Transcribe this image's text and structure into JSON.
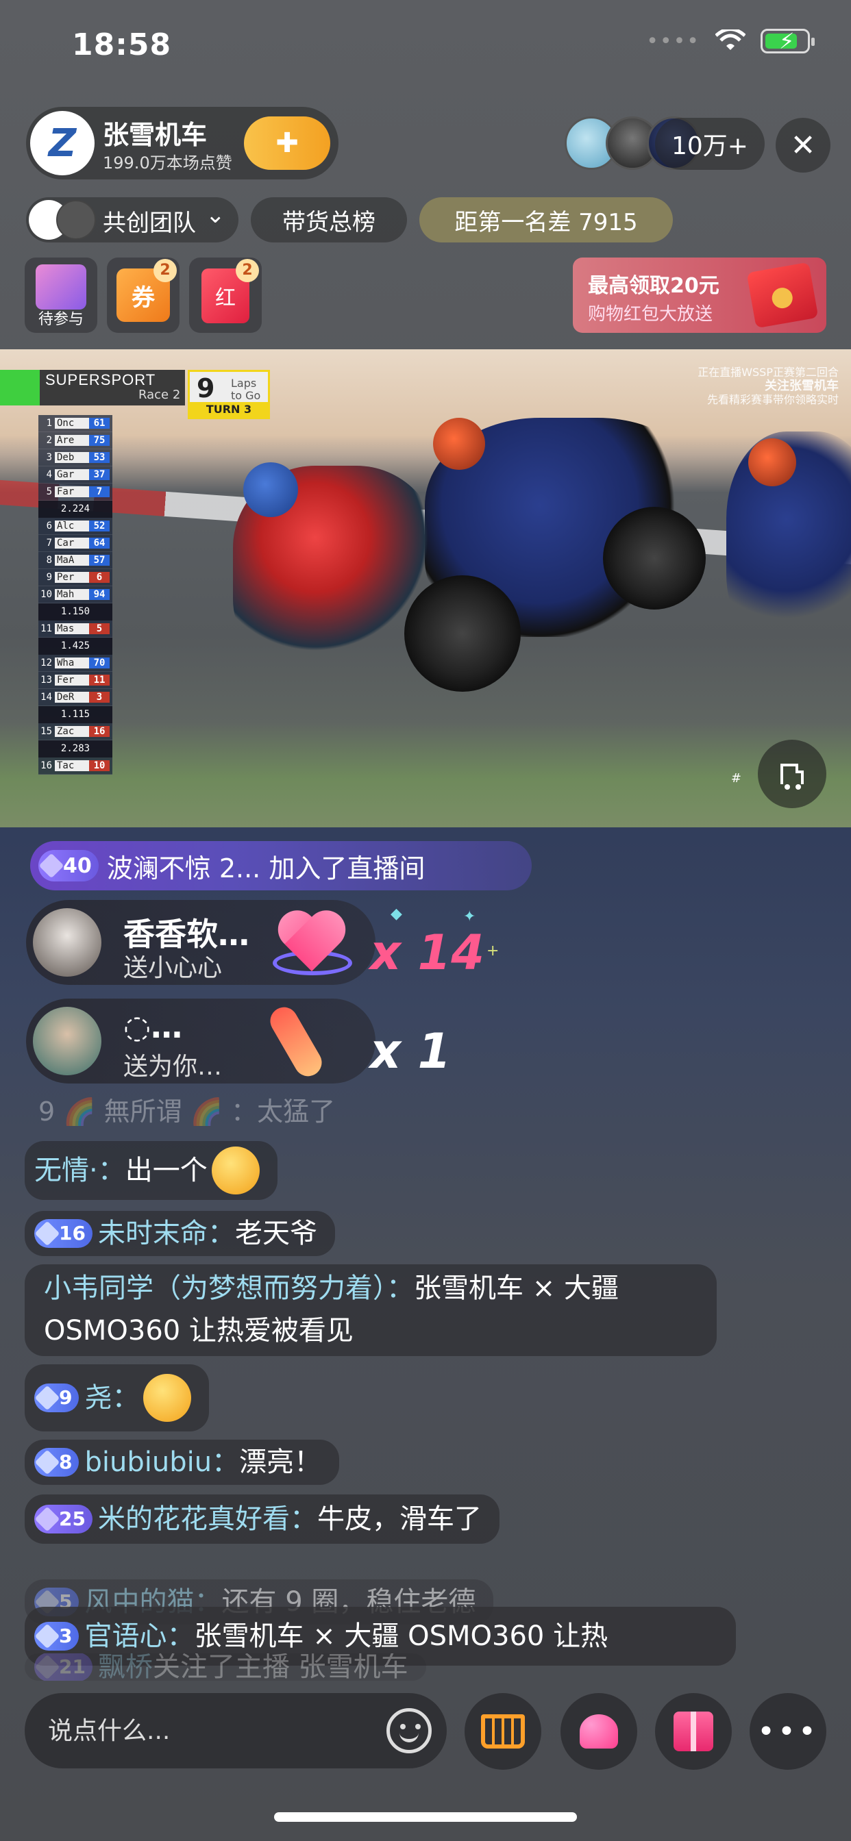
{
  "status_bar": {
    "time": "18:58"
  },
  "host": {
    "name": "张雪机车",
    "likes": "199.0万本场点赞",
    "follow_label": "✚"
  },
  "viewer_count": "10万+",
  "close_label": "✕",
  "team": {
    "label": "共创团队",
    "chevron": "⌄"
  },
  "rank_label": "带货总榜",
  "gap_label": "距第一名差 7915",
  "activities": [
    {
      "label": "待参与"
    },
    {
      "glyph": "券",
      "badge": "2"
    },
    {
      "glyph": "红",
      "badge": "2"
    }
  ],
  "redpacket": {
    "title": "最高领取20元",
    "subtitle": "购物红包大放送"
  },
  "video": {
    "series": "SUPERSPORT",
    "race": "Race 2",
    "laps_num": "9",
    "laps_label_1": "Laps",
    "laps_label_2": "to Go",
    "turn": "TURN 3",
    "watermark_1": "正在直播WSSP正赛第二回合",
    "watermark_2": "关注张雪机车",
    "watermark_3": "先看精彩赛事带你领略实时",
    "hash": "#",
    "standings": [
      {
        "pos": "1",
        "nm": "Onc",
        "num": "61",
        "color": "#2a66d8"
      },
      {
        "pos": "2",
        "nm": "Are",
        "num": "75",
        "color": "#2a66d8"
      },
      {
        "pos": "3",
        "nm": "Deb",
        "num": "53",
        "color": "#2a66d8"
      },
      {
        "pos": "4",
        "nm": "Gar",
        "num": "37",
        "color": "#2a66d8"
      },
      {
        "pos": "5",
        "nm": "Far",
        "num": "7",
        "color": "#2a66d8"
      },
      {
        "gap": "2.224"
      },
      {
        "pos": "6",
        "nm": "Alc",
        "num": "52",
        "color": "#2a66d8"
      },
      {
        "pos": "7",
        "nm": "Car",
        "num": "64",
        "color": "#2a66d8"
      },
      {
        "pos": "8",
        "nm": "MaA",
        "num": "57",
        "color": "#2a66d8"
      },
      {
        "pos": "9",
        "nm": "Per",
        "num": "6",
        "color": "#c0392b"
      },
      {
        "pos": "10",
        "nm": "Mah",
        "num": "94",
        "color": "#2a66d8"
      },
      {
        "gap": "1.150"
      },
      {
        "pos": "11",
        "nm": "Mas",
        "num": "5",
        "color": "#c0392b"
      },
      {
        "gap": "1.425"
      },
      {
        "pos": "12",
        "nm": "Wha",
        "num": "70",
        "color": "#2a66d8"
      },
      {
        "pos": "13",
        "nm": "Fer",
        "num": "11",
        "color": "#c0392b"
      },
      {
        "pos": "14",
        "nm": "DeR",
        "num": "3",
        "color": "#c0392b"
      },
      {
        "gap": "1.115"
      },
      {
        "pos": "15",
        "nm": "Zac",
        "num": "16",
        "color": "#c0392b"
      },
      {
        "gap": "2.283"
      },
      {
        "pos": "16",
        "nm": "Tac",
        "num": "10",
        "color": "#c0392b"
      }
    ]
  },
  "join": {
    "level": "40",
    "text": "波澜不惊 2... 加入了直播间"
  },
  "gifts": [
    {
      "name": "香香软…",
      "action": "送小心心",
      "count": "x 14"
    },
    {
      "name": "◌…",
      "action": "送为你…",
      "count": "x 1"
    }
  ],
  "faded_msg": "9 🌈 無所谓 🌈 ：太猛了",
  "messages": [
    {
      "user": "无情·：",
      "text": "出一个"
    },
    {
      "level": "16",
      "user": "未时末命：",
      "text": "老天爷"
    },
    {
      "user": "小韦同学（为梦想而努力着）：",
      "text": "张雪机车 × 大疆 OSMO360 让热爱被看见"
    },
    {
      "level": "9",
      "user": "尧：",
      "text": ""
    },
    {
      "level": "8",
      "user": "biubiubiu：",
      "text": "漂亮！"
    },
    {
      "level": "25",
      "user": "米的花花真好看：",
      "text": "牛皮，滑车了"
    },
    {
      "level": "5",
      "user": "风中的猫：",
      "text": "还有 9 圈，稳住老德"
    },
    {
      "level": "3",
      "user": "官语心：",
      "text": "张雪机车 × 大疆 OSMO360 让热"
    },
    {
      "level": "21",
      "user": "飘桥 ",
      "text": "关注了主播 张雪机车"
    }
  ],
  "input": {
    "placeholder": "说点什么..."
  },
  "more_label": "•••"
}
